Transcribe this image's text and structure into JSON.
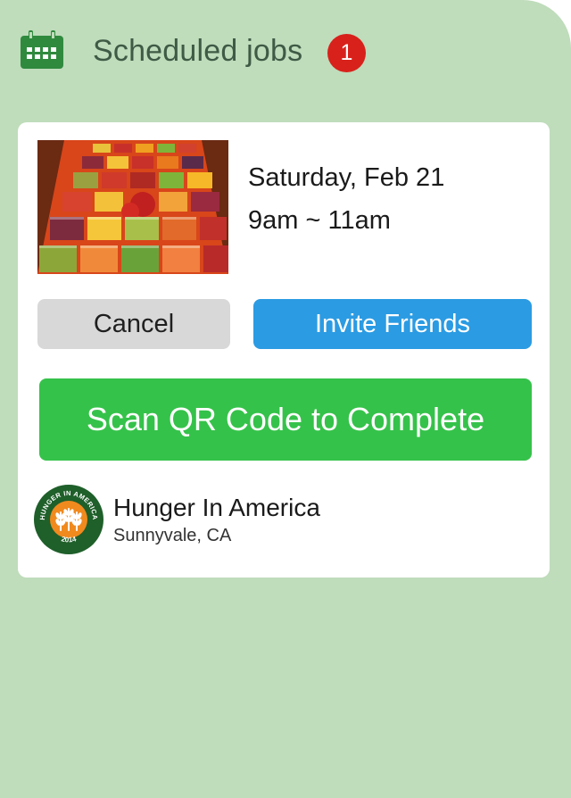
{
  "header": {
    "title": "Scheduled jobs",
    "badge_count": "1",
    "icon": "calendar-icon"
  },
  "job": {
    "image": "fruit-tray-photo",
    "date": "Saturday, Feb 21",
    "time": "9am ~ 11am",
    "buttons": {
      "cancel": "Cancel",
      "invite": "Invite Friends",
      "scan": "Scan QR Code to Complete"
    },
    "organization": {
      "name": "Hunger In America",
      "location": "Sunnyvale, CA",
      "logo_text_top": "HUNGER IN AMERICA",
      "logo_text_bottom": "2014"
    }
  },
  "colors": {
    "background": "#bfdcbb",
    "header_text": "#3f5a45",
    "badge": "#d8211b",
    "cancel_button": "#d8d8d8",
    "invite_button": "#2b9be3",
    "scan_button": "#35c24a",
    "calendar_icon": "#2f8a3e"
  }
}
